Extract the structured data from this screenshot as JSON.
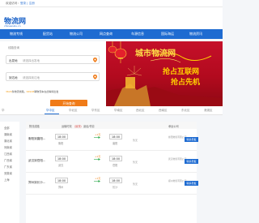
{
  "topbar": {
    "prefix": "欢迎访问：",
    "links": "登录 | 注册"
  },
  "logo": {
    "title": "物流网",
    "url": "chinawuliu.cn"
  },
  "nav": {
    "items": [
      {
        "label": "物流专线"
      },
      {
        "label": "配货站"
      },
      {
        "label": "物流公司"
      },
      {
        "label": "网点查询"
      },
      {
        "label": "车源信息"
      },
      {
        "label": "国际海运"
      },
      {
        "label": "物流资讯"
      }
    ]
  },
  "search": {
    "header": "线路查询",
    "from_label": "出发地",
    "from_placeholder": "请选择出发地",
    "to_label": "到达地",
    "to_placeholder": "请选择到达地",
    "note_highlight": "3624",
    "note_mid": "条物流线路，",
    "note_highlight2": "64918",
    "note_rest": "辆物流车在此等候出发",
    "button": "开始查询"
  },
  "banner": {
    "title": "城市物流网",
    "line1": "抢占互联网",
    "line2": "抢占先机"
  },
  "regions": {
    "items": [
      "华",
      "华中区",
      "华北区",
      "华东区",
      "华南区",
      "西北区",
      "西南区",
      "东北区",
      "港澳区"
    ],
    "active_index": 1
  },
  "sidebar": {
    "items": [
      "全部",
      "湖南省",
      "湖北省",
      "河南省",
      "江西省",
      "广西省",
      "广东省",
      "安徽省",
      "上海"
    ]
  },
  "table": {
    "headers": {
      "route": "物流线路",
      "time": "运输时效",
      "red_note": "（最快）",
      "stops": "途经/停靠",
      "company": "承运公司"
    },
    "rows": [
      {
        "route": "衡阳到襄阳...",
        "depart_time": "18:00",
        "depart_city": "衡阳",
        "arrive_time": "18:00",
        "arrive_city": "襄阳",
        "duration": "+1天",
        "mid": "暂无",
        "company": "衡阳物流有限公司",
        "action": "联系老板"
      },
      {
        "route": "武汉到岳阳...",
        "depart_time": "18:00",
        "depart_city": "武汉",
        "arrive_time": "18:00",
        "arrive_city": "岳阳",
        "duration": "+1天",
        "mid": "暂无",
        "company": "武汉物流有限公司",
        "action": "联系老板"
      },
      {
        "route": "郑州到长沙...",
        "depart_time": "18:00",
        "depart_city": "郑州",
        "arrive_time": "18:00",
        "arrive_city": "长沙",
        "duration": "+1天",
        "mid": "暂无",
        "company": "郑州物流有限公司",
        "action": "联系老板"
      }
    ]
  },
  "colors": {
    "brand_blue": "#1e6bd1",
    "accent_orange": "#f07b18",
    "banner_red": "#b20a1e",
    "banner_gold": "#ffd000"
  }
}
